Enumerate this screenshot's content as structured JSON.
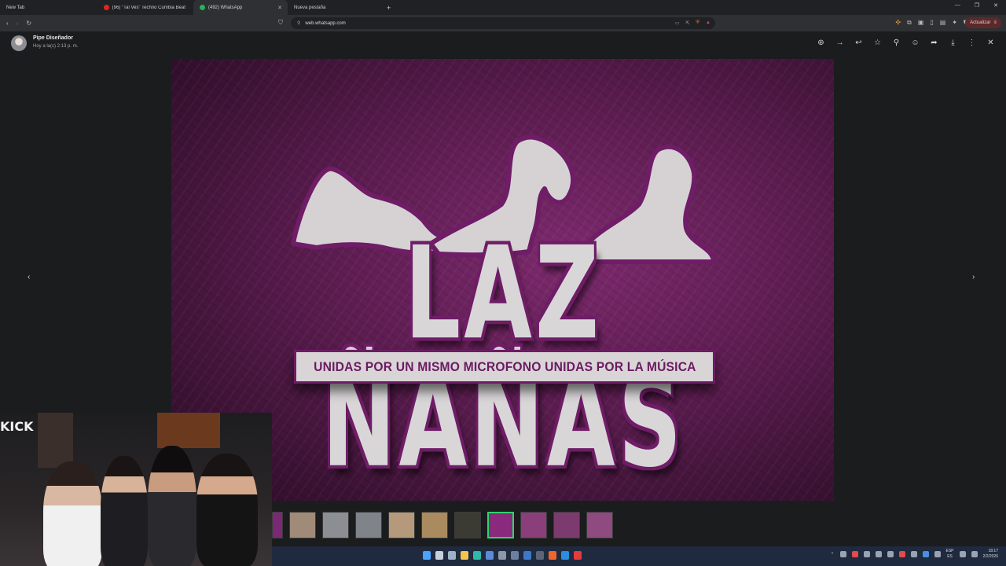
{
  "browser": {
    "tabs": [
      {
        "label": "New Tab"
      },
      {
        "label": "(96) \"Tal Ves\" Techno Cumbia Beat In"
      },
      {
        "label": "(492) WhatsApp"
      },
      {
        "label": "Nueva pestaña"
      }
    ],
    "url": "web.whatsapp.com",
    "update_label": "Actualizar"
  },
  "viewer": {
    "sender": "Pipe Diseñador",
    "time": "Hoy a la(s) 2:13 p. m.",
    "prev_glyph": "‹",
    "next_glyph": "›"
  },
  "artwork": {
    "brand_text": "LAZ ÑAÑAS",
    "slogan": "UNIDAS POR UN MISMO MICROFONO  UNIDAS POR LA MÚSICA",
    "colors": {
      "background": "#5b1c4f",
      "outline": "#6e1d66",
      "letters": "#d9d6d8"
    }
  },
  "webcam": {
    "sign_text": "KICK"
  },
  "taskbar": {
    "lang_top": "ESP",
    "lang_bottom": "ES",
    "clock_time": "18:17",
    "clock_date": "2/2/2026"
  }
}
